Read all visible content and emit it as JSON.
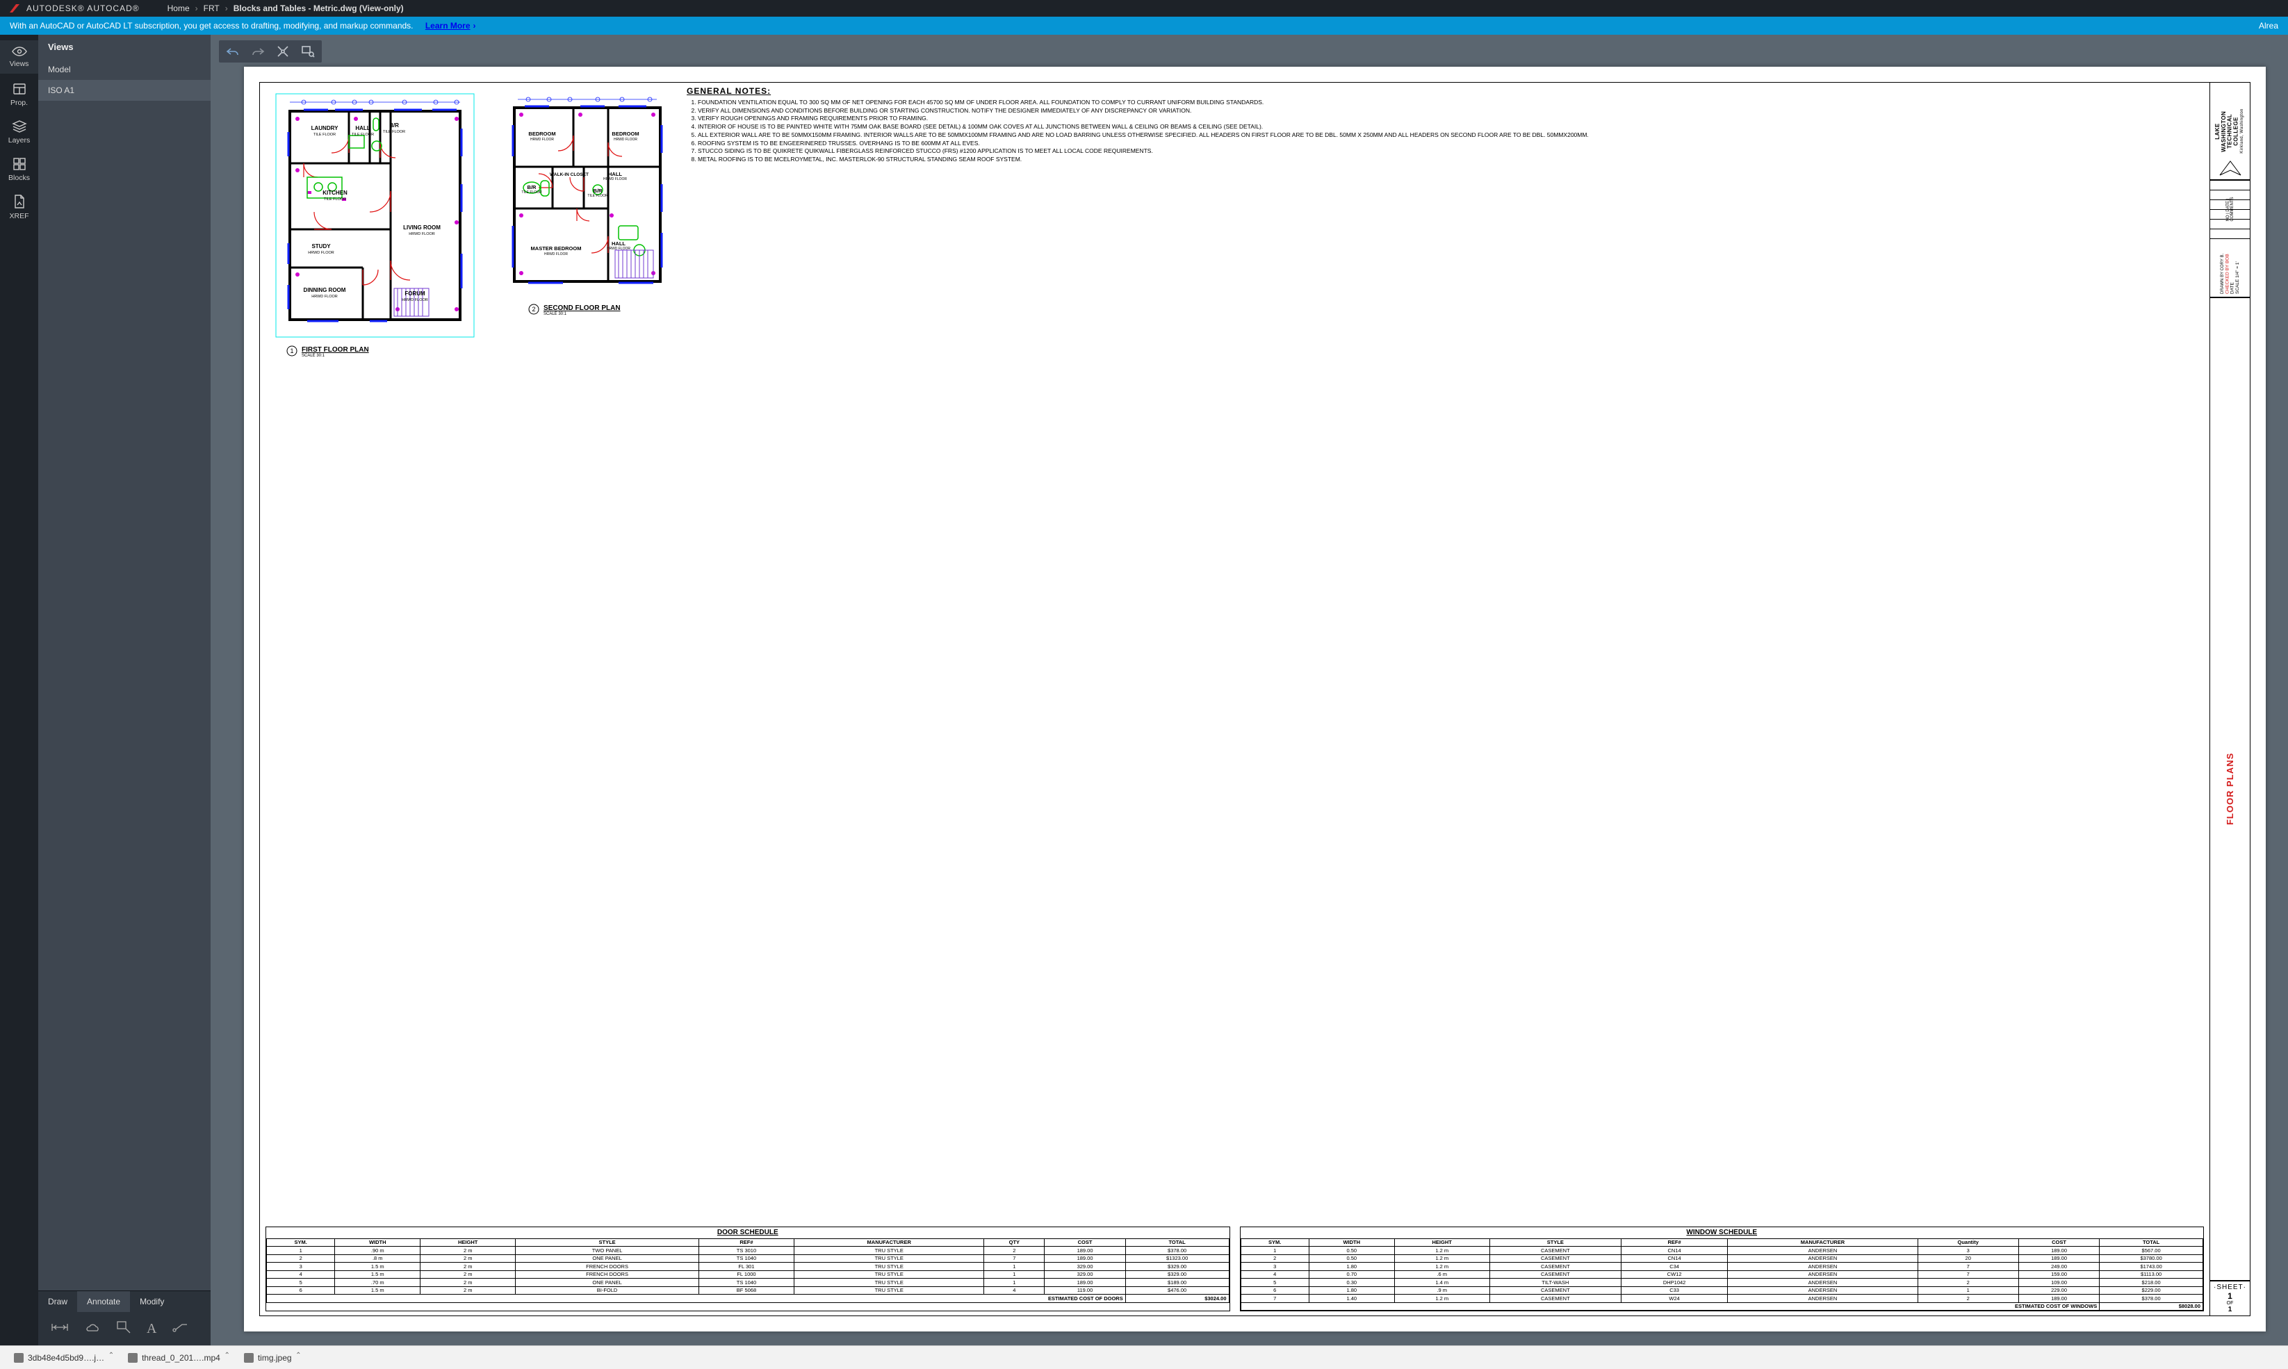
{
  "header": {
    "brand": "AUTODESK® AUTOCAD®",
    "crumbs": [
      "Home",
      "FRT",
      "Blocks and Tables - Metric.dwg (View-only)"
    ]
  },
  "banner": {
    "msg": "With an AutoCAD or AutoCAD LT subscription, you get access to drafting, modifying, and markup commands.",
    "learn": "Learn More",
    "right": "Alrea"
  },
  "rail": {
    "items": [
      {
        "label": "Views"
      },
      {
        "label": "Prop."
      },
      {
        "label": "Layers"
      },
      {
        "label": "Blocks"
      },
      {
        "label": "XREF"
      }
    ]
  },
  "panel": {
    "title": "Views",
    "items": [
      {
        "label": "Model"
      },
      {
        "label": "ISO A1"
      }
    ]
  },
  "tooltabs": {
    "items": [
      "Draw",
      "Annotate",
      "Modify"
    ]
  },
  "notes_title": "GENERAL NOTES:",
  "notes": [
    "FOUNDATION VENTILATION EQUAL TO 300 SQ MM OF NET OPENING FOR EACH 45700 SQ MM OF UNDER FLOOR AREA. ALL FOUNDATION TO COMPLY TO CURRANT UNIFORM BUILDING STANDARDS.",
    "VERIFY ALL DIMENSIONS AND CONDITIONS BEFORE BUILDING OR STARTING CONSTRUCTION. NOTIFY THE DESIGNER IMMEDIATELY OF ANY DISCREPANCY OR VARIATION.",
    "VERIFY ROUGH OPENINGS AND FRAMING REQUIREMENTS PRIOR TO FRAMING.",
    "INTERIOR OF HOUSE IS TO BE PAINTED WHITE WITH 75MM OAK BASE BOARD (SEE DETAIL) & 100MM OAK COVES AT ALL JUNCTIONS BETWEEN WALL & CEILING OR BEAMS & CEILING (SEE DETAIL).",
    "ALL EXTERIOR WALL ARE TO BE 50MMX150MM FRAMING. INTERIOR WALLS ARE TO BE 50MMX100MM FRAMING AND ARE NO LOAD BARRING UNLESS OTHERWISE SPECIFIED. ALL HEADERS ON FIRST FLOOR ARE TO BE DBL. 50MM X 250MM AND ALL HEADERS ON SECOND FLOOR ARE TO BE DBL. 50MMX200MM.",
    "ROOFING SYSTEM IS TO BE ENGEERINERED TRUSSES. OVERHANG IS TO BE 600MM AT ALL EVES.",
    "STUCCO SIDING IS TO BE QUIKRETE QUIKWALL FIBERGLASS REINFORCED STUCCO (FRS) #1200  APPLICATION IS TO MEET ALL LOCAL CODE REQUIREMENTS.",
    "METAL ROOFING IS TO BE MCELROYMETAL, INC. MASTERLOK-90 STRUCTURAL STANDING SEAM ROOF SYSTEM."
  ],
  "plan1": {
    "title": "FIRST FLOOR PLAN",
    "scale": "SCALE 30:1",
    "rooms": [
      "LAUNDRY",
      "HALL",
      "B/R",
      "KITCHEN",
      "STUDY",
      "DINNING ROOM",
      "LIVING ROOM",
      "FORUM"
    ],
    "floor": [
      "TILE FLOOR",
      "TILE FLOOR",
      "TILE FLOOR",
      "HRWD FLOOR",
      "HRWD FLOOR",
      "HRWD FLOOR",
      "HRWD FLOOR"
    ]
  },
  "plan2": {
    "title": "SECOND FLOOR PLAN",
    "scale": "SCALE 30:1",
    "rooms": [
      "BEDROOM",
      "BEDROOM",
      "B/R",
      "HALL",
      "WALK-IN CLOSET",
      "B/R",
      "MASTER BEDROOM",
      "HALL"
    ],
    "floor": [
      "HRWD FLOOR",
      "HRWD FLOOR",
      "TILE FLOOR",
      "HRWD FLOOR",
      "",
      "TILE FLOOR",
      "HRWD FLOOR",
      "HRWD FLOOR"
    ]
  },
  "door_sched": {
    "title": "DOOR SCHEDULE",
    "cols": [
      "SYM.",
      "WIDTH",
      "HEIGHT",
      "STYLE",
      "REF#",
      "MANUFACTURER",
      "QTY",
      "COST",
      "TOTAL"
    ],
    "rows": [
      [
        "1",
        ".90 m",
        "2 m",
        "TWO PANEL",
        "TS 3010",
        "TRU STYLE",
        "2",
        "189.00",
        "$378.00"
      ],
      [
        "2",
        ".8 m",
        "2 m",
        "ONE PANEL",
        "TS 1040",
        "TRU STYLE",
        "7",
        "189.00",
        "$1323.00"
      ],
      [
        "3",
        "1.5 m",
        "2 m",
        "FRENCH DOORS",
        "FL 301",
        "TRU STYLE",
        "1",
        "329.00",
        "$329.00"
      ],
      [
        "4",
        "1.5 m",
        "2 m",
        "FRENCH DOORS",
        "FL 1000",
        "TRU STYLE",
        "1",
        "329.00",
        "$329.00"
      ],
      [
        "5",
        ".70 m",
        "2 m",
        "ONE PANEL",
        "TS 1040",
        "TRU STYLE",
        "1",
        "189.00",
        "$189.00"
      ],
      [
        "6",
        "1.5 m",
        "2 m",
        "BI-FOLD",
        "BF 5068",
        "TRU STYLE",
        "4",
        "119.00",
        "$476.00"
      ]
    ],
    "total_label": "ESTIMATED COST OF DOORS",
    "total": "$3024.00"
  },
  "window_sched": {
    "title": "WINDOW SCHEDULE",
    "cols": [
      "SYM.",
      "WIDTH",
      "HEIGHT",
      "STYLE",
      "REF#",
      "MANUFACTURER",
      "Quantity",
      "COST",
      "TOTAL"
    ],
    "rows": [
      [
        "1",
        "0.50",
        "1.2 m",
        "CASEMENT",
        "CN14",
        "ANDERSEN",
        "3",
        "189.00",
        "$567.00"
      ],
      [
        "2",
        "0.50",
        "1.2 m",
        "CASEMENT",
        "CN14",
        "ANDERSEN",
        "20",
        "189.00",
        "$3780.00"
      ],
      [
        "3",
        "1.80",
        "1.2 m",
        "CASEMENT",
        "C34",
        "ANDERSEN",
        "7",
        "249.00",
        "$1743.00"
      ],
      [
        "4",
        "0.70",
        ".6 m",
        "CASEMENT",
        "CW12",
        "ANDERSEN",
        "7",
        "159.00",
        "$1113.00"
      ],
      [
        "5",
        "0.30",
        "1.4 m",
        "TILT-WASH",
        "DHP1042",
        "ANDERSEN",
        "2",
        "109.00",
        "$218.00"
      ],
      [
        "6",
        "1.80",
        ".9 m",
        "CASEMENT",
        "C33",
        "ANDERSEN",
        "1",
        "229.00",
        "$229.00"
      ],
      [
        "7",
        "1.40",
        "1.2 m",
        "CASEMENT",
        "W24",
        "ANDERSEN",
        "2",
        "189.00",
        "$378.00"
      ]
    ],
    "total_label": "ESTIMATED COST OF WINDOWS",
    "total": "$8028.00"
  },
  "titleblock": {
    "college": "LAKE WASHINGTON TECHNICAL COLLEGE",
    "city": "Kirkland, Washington",
    "sheet_label": "SHEET",
    "sheet": "1",
    "of": "OF",
    "of_n": "1",
    "fp": "FLOOR PLANS",
    "credit": [
      "DRAWN BY CORY B.",
      "CHECKED BY BOB",
      "DATE",
      "SCALE 1/4\" = 1'"
    ]
  },
  "taskbar": {
    "items": [
      "3db48e4d5bd9….j…",
      "thread_0_201….mp4",
      "timg.jpeg"
    ]
  }
}
